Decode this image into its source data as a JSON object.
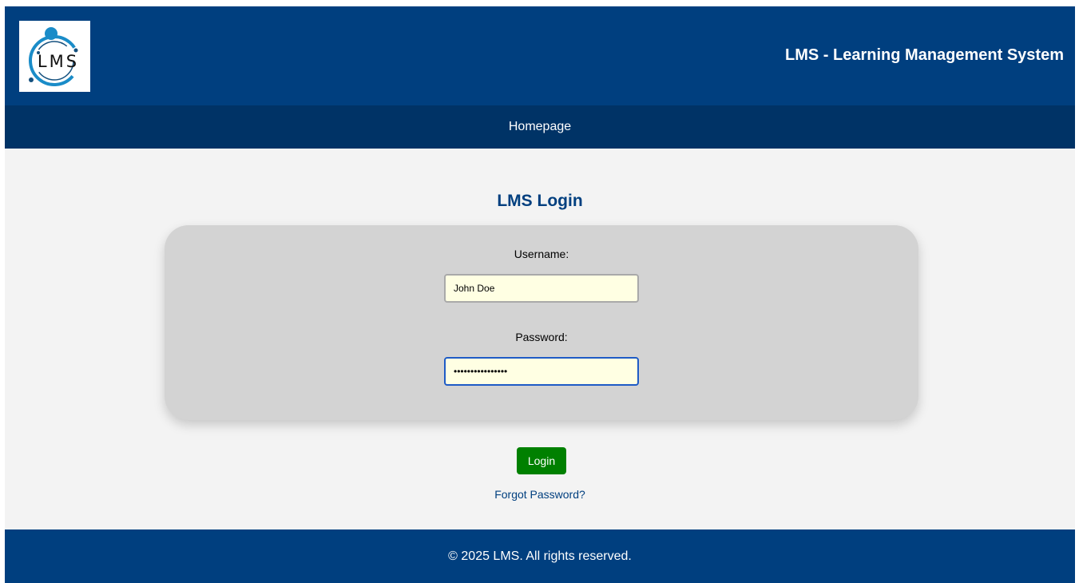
{
  "header": {
    "logo_text": "LMS",
    "title": "LMS - Learning Management System"
  },
  "nav": {
    "items": [
      {
        "label": "Homepage"
      }
    ]
  },
  "login": {
    "heading": "LMS Login",
    "username_label": "Username:",
    "username_value": "John Doe",
    "password_label": "Password:",
    "password_value": "••••••••••••••••",
    "button_label": "Login",
    "forgot_label": "Forgot Password?"
  },
  "footer": {
    "text": "© 2025 LMS. All rights reserved."
  },
  "colors": {
    "header_bg": "#003f7f",
    "nav_bg": "#003366",
    "page_bg": "#f3f3f3",
    "card_bg": "#d3d3d3",
    "input_bg": "#ffffe3",
    "button_bg": "#008000",
    "heading_color": "#003f7f",
    "logo_accent": "#1a8cc8"
  },
  "icons": {
    "logo": "lms-orbit-logo"
  }
}
